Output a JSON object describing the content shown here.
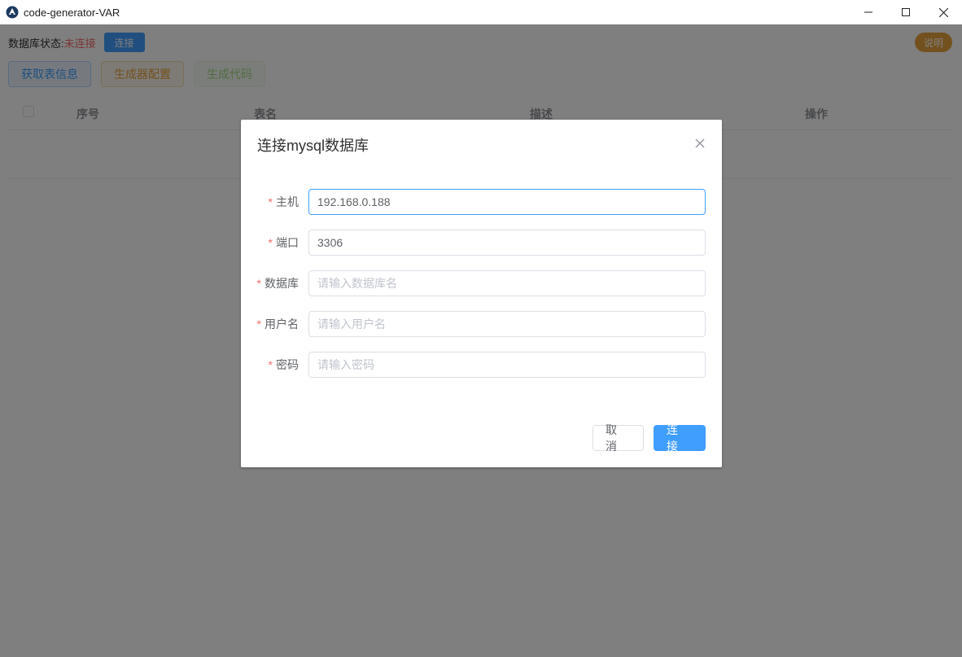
{
  "window": {
    "title": "code-generator-VAR",
    "minimize_glyph": "—",
    "maximize_glyph": "☐",
    "close_glyph": "✕"
  },
  "status": {
    "label": "数据库状态:",
    "value": "未连接",
    "connect_label": "连接"
  },
  "help_label": "说明",
  "actions": {
    "fetch_tables": "获取表信息",
    "generator_config": "生成器配置",
    "generate_code": "生成代码"
  },
  "table": {
    "columns": [
      "序号",
      "表名",
      "描述",
      "操作"
    ]
  },
  "dialog": {
    "title": "连接mysql数据库",
    "fields": [
      {
        "label": "主机",
        "value": "192.168.0.188",
        "placeholder": ""
      },
      {
        "label": "端口",
        "value": "3306",
        "placeholder": ""
      },
      {
        "label": "数据库",
        "value": "",
        "placeholder": "请输入数据库名"
      },
      {
        "label": "用户名",
        "value": "",
        "placeholder": "请输入用户名"
      },
      {
        "label": "密码",
        "value": "",
        "placeholder": "请输入密码"
      }
    ],
    "cancel_label": "取消",
    "connect_label": "连接"
  },
  "colors": {
    "primary": "#409eff",
    "warning": "#e6a23c",
    "success": "#67c23a",
    "danger": "#f56c6c"
  }
}
